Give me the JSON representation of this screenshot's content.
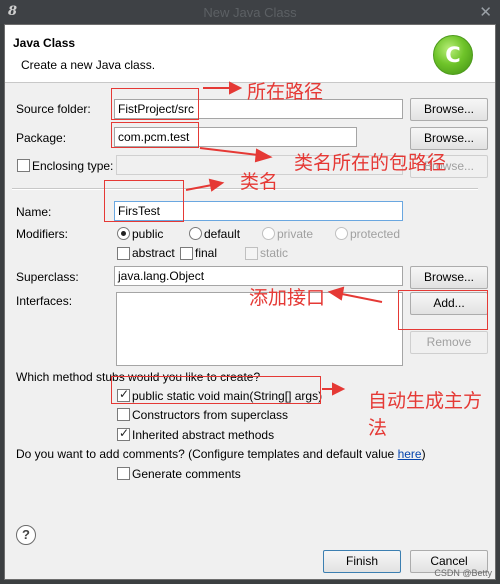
{
  "window": {
    "title": "New Java Class",
    "close": "✕"
  },
  "header": {
    "title": "Java Class",
    "description": "Create a new Java class.",
    "logo": "C"
  },
  "source_folder": {
    "label": "Source folder:",
    "value": "FistProject/src",
    "browse": "Browse..."
  },
  "package": {
    "label": "Package:",
    "value": "com.pcm.test",
    "browse": "Browse..."
  },
  "enclosing": {
    "label": "Enclosing type:",
    "browse": "Browse..."
  },
  "name": {
    "label": "Name:",
    "value": "FirsTest"
  },
  "modifiers": {
    "label": "Modifiers:",
    "public": "public",
    "default": "default",
    "private": "private",
    "protected": "protected",
    "abstract": "abstract",
    "final": "final",
    "static": "static"
  },
  "superclass": {
    "label": "Superclass:",
    "value": "java.lang.Object",
    "browse": "Browse..."
  },
  "interfaces": {
    "label": "Interfaces:",
    "add": "Add...",
    "remove": "Remove"
  },
  "stubs": {
    "question": "Which method stubs would you like to create?",
    "main": "public static void main(String[] args)",
    "constructors": "Constructors from superclass",
    "inherited": "Inherited abstract methods"
  },
  "comments": {
    "question_prefix": "Do you want to add comments? (Configure templates and default value ",
    "link": "here",
    "question_suffix": ")",
    "generate": "Generate comments"
  },
  "footer": {
    "help": "?",
    "finish": "Finish",
    "cancel": "Cancel",
    "watermark": "CSDN @Betty"
  },
  "annotations": {
    "path": "所在路径",
    "package_path": "类名所在的包路径",
    "class_name": "类名",
    "add_interface": "添加接口",
    "auto_main": "自动生成主方",
    "auto_main_2": "法",
    "color": "#e53935"
  }
}
